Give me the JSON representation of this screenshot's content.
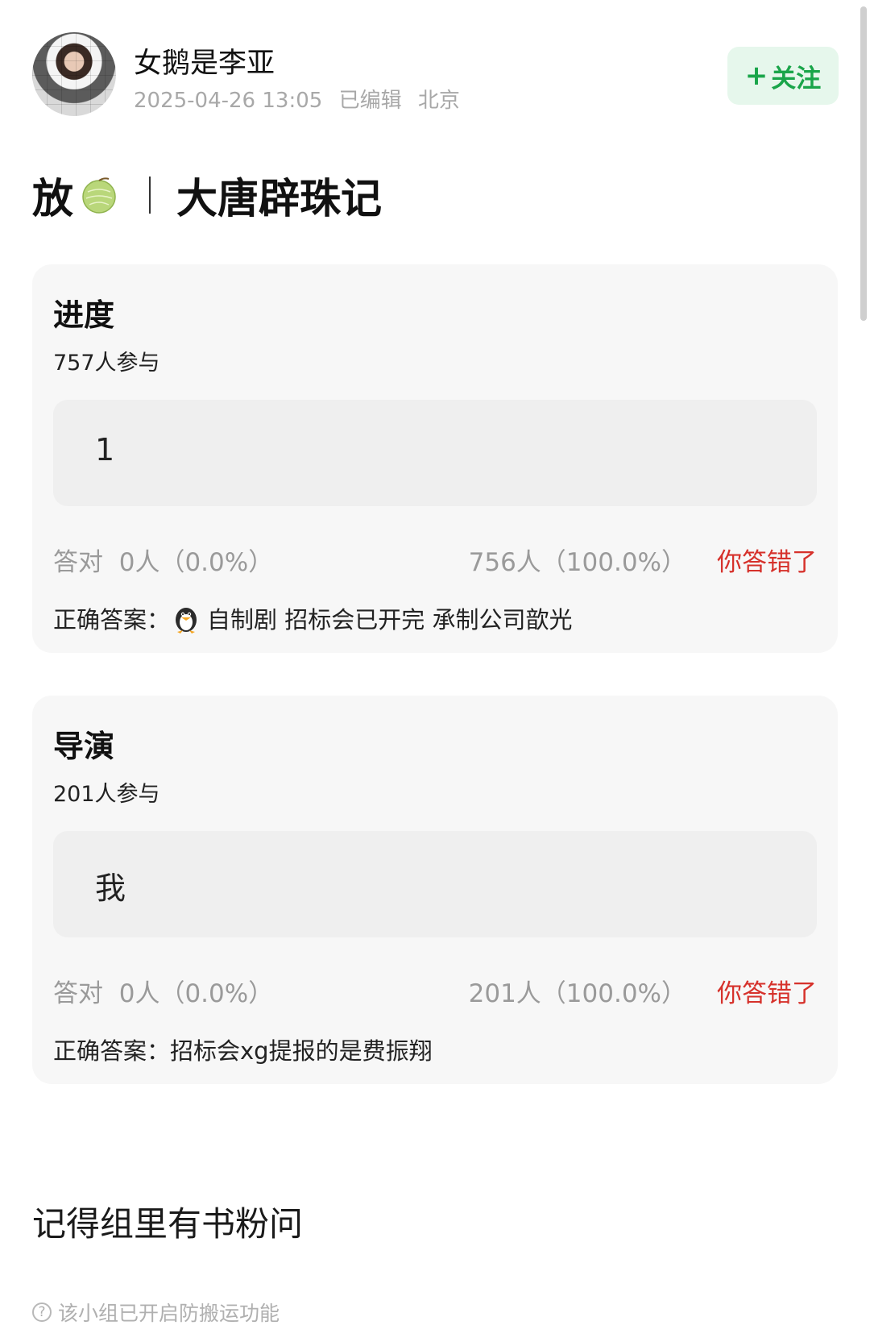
{
  "author": {
    "name": "女鹅是李亚",
    "timestamp": "2025-04-26 13:05",
    "edited": "已编辑",
    "location": "北京"
  },
  "follow": {
    "plus": "+",
    "label": "关注",
    "color": "#1aa54a"
  },
  "post": {
    "title_prefix": "放",
    "title_emoji": "melon-emoji",
    "title_main": "大唐辟珠记"
  },
  "questions": [
    {
      "title": "进度",
      "participants": "757人参与",
      "my_answer": "1",
      "right_label": "答对",
      "right_count": "0人（0.0%）",
      "wrong_count": "756人（100.0%）",
      "result": "你答错了",
      "correct_label": "正确答案：",
      "correct_answer": "自制剧 招标会已开完 承制公司歆光"
    },
    {
      "title": "导演",
      "participants": "201人参与",
      "my_answer": "我",
      "right_label": "答对",
      "right_count": "0人（0.0%）",
      "wrong_count": "201人（100.0%）",
      "result": "你答错了",
      "correct_label": "正确答案：",
      "correct_answer": "招标会xg提报的是费振翔"
    }
  ],
  "body_text": "记得组里有书粉问",
  "footer": {
    "icon": "help-icon",
    "text": "该小组已开启防搬运功能"
  },
  "colors": {
    "wrong": "#d6312b",
    "card_bg": "#f7f7f7"
  }
}
